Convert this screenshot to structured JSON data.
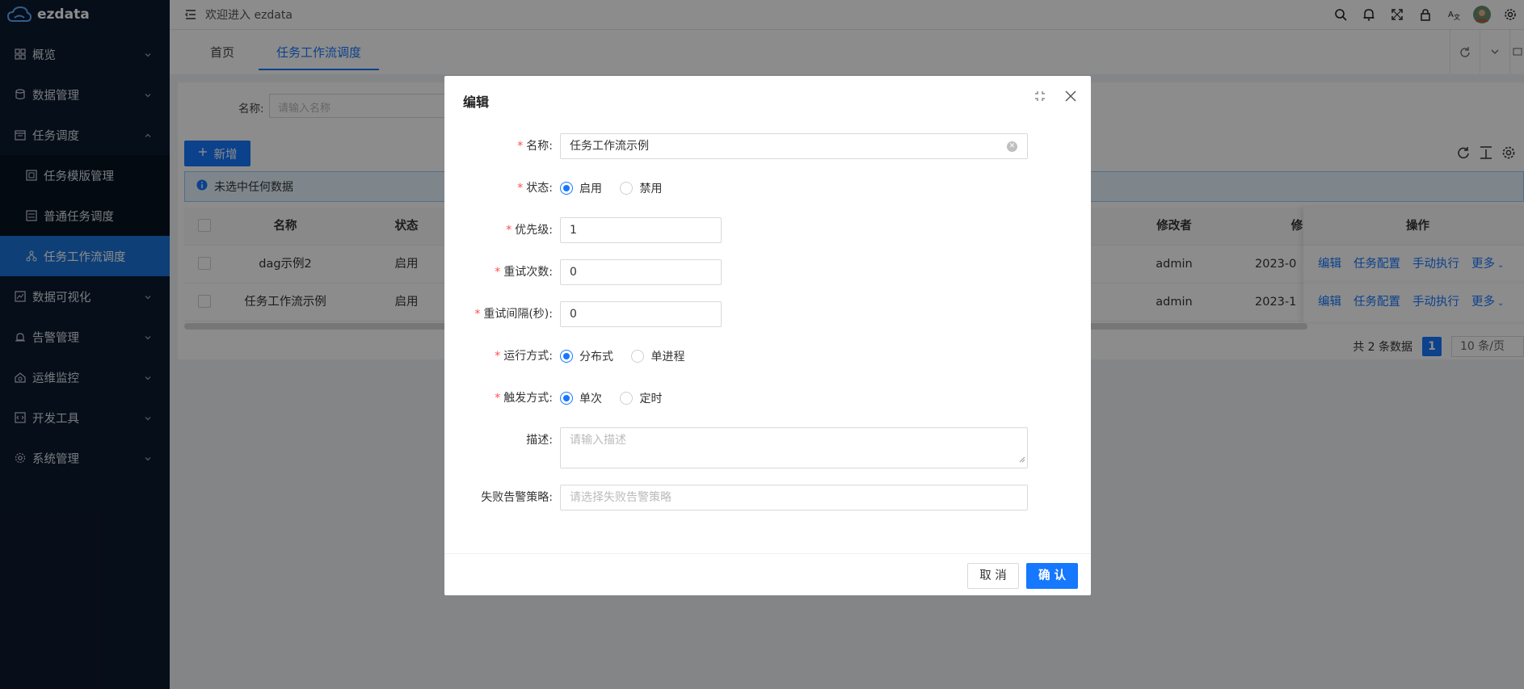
{
  "app": {
    "name": "ezdata"
  },
  "sidebar": {
    "items": [
      {
        "label": "概览"
      },
      {
        "label": "数据管理"
      },
      {
        "label": "任务调度"
      },
      {
        "label": "任务模版管理"
      },
      {
        "label": "普通任务调度"
      },
      {
        "label": "任务工作流调度"
      },
      {
        "label": "数据可视化"
      },
      {
        "label": "告警管理"
      },
      {
        "label": "运维监控"
      },
      {
        "label": "开发工具"
      },
      {
        "label": "系统管理"
      }
    ]
  },
  "header": {
    "welcome": "欢迎进入 ezdata"
  },
  "tabs": [
    {
      "label": "首页"
    },
    {
      "label": "任务工作流调度"
    }
  ],
  "search": {
    "label": "名称:",
    "placeholder": "请输入名称"
  },
  "toolbar": {
    "add_label": "新增"
  },
  "alert": {
    "text": "未选中任何数据"
  },
  "table": {
    "headers": {
      "name": "名称",
      "status": "状态",
      "modifier": "修改者",
      "col_cut": "修",
      "actions": "操作"
    },
    "rows": [
      {
        "name": "dag示例2",
        "status": "启用",
        "modifier": "admin",
        "time": "2023-0"
      },
      {
        "name": "任务工作流示例",
        "status": "启用",
        "modifier": "admin",
        "time": "2023-1"
      }
    ],
    "actions": {
      "edit": "编辑",
      "config": "任务配置",
      "run": "手动执行",
      "more": "更多"
    }
  },
  "pagination": {
    "total": "共 2 条数据",
    "current": "1",
    "size": "10 条/页"
  },
  "modal": {
    "title": "编辑",
    "fields": {
      "name": {
        "label": "名称",
        "value": "任务工作流示例"
      },
      "status": {
        "label": "状态",
        "options": [
          "启用",
          "禁用"
        ],
        "selected": "启用"
      },
      "priority": {
        "label": "优先级",
        "value": "1"
      },
      "retry_count": {
        "label": "重试次数",
        "value": "0"
      },
      "retry_interval": {
        "label": "重试间隔(秒)",
        "value": "0"
      },
      "run_mode": {
        "label": "运行方式",
        "options": [
          "分布式",
          "单进程"
        ],
        "selected": "分布式"
      },
      "trigger_mode": {
        "label": "触发方式",
        "options": [
          "单次",
          "定时"
        ],
        "selected": "单次"
      },
      "description": {
        "label": "描述",
        "placeholder": "请输入描述"
      },
      "alert_strategy": {
        "label": "失败告警策略",
        "placeholder": "请选择失败告警策略"
      }
    },
    "cancel_label": "取 消",
    "confirm_label": "确 认"
  },
  "colors": {
    "primary": "#1677ff",
    "sidebar_bg": "#0c1a2e",
    "required": "#ff4d4f"
  }
}
